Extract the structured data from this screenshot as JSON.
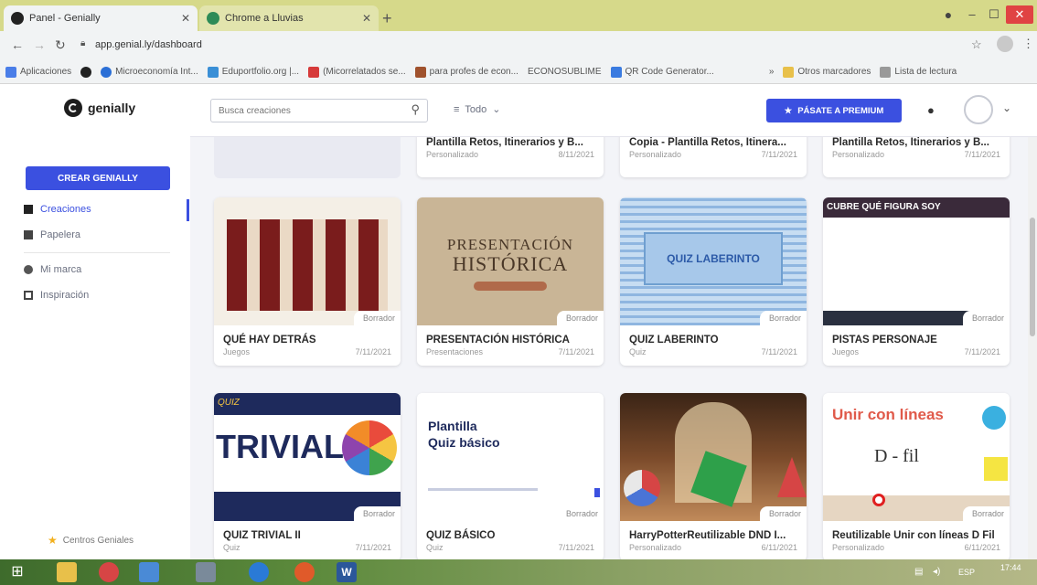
{
  "browser": {
    "tabs": [
      {
        "title": "Panel - Genially",
        "active": true
      },
      {
        "title": "Chrome a Lluvias",
        "active": false
      }
    ],
    "address": "app.genial.ly/dashboard",
    "bookmarks": [
      "Aplicaciones",
      "Microeconomía Int...",
      "Eduportfolio.org |...",
      "(Micorrelatados se...",
      "para profes de econ...",
      "ECONOSUBLIME",
      "QR Code Generator...",
      "Otros marcadores",
      "Lista de lectura"
    ]
  },
  "app": {
    "logo": "genially",
    "create_button": "CREAR GENIALLY",
    "nav": [
      "Creaciones",
      "Papelera",
      "Mi marca",
      "Inspiración"
    ],
    "footer_link": "Centros Geniales",
    "search_placeholder": "Busca creaciones",
    "filter_label": "Todo",
    "premium_button": "PÁSATE A PREMIUM"
  },
  "cards_top": [
    {
      "title": "Plantilla Retos, Itinerarios y B...",
      "type": "Personalizado",
      "date": "8/11/2021"
    },
    {
      "title": "Copia - Plantilla Retos, Itinera...",
      "type": "Personalizado",
      "date": "7/11/2021"
    },
    {
      "title": "Plantilla Retos, Itinerarios y B...",
      "type": "Personalizado",
      "date": "7/11/2021"
    }
  ],
  "cards_row2": [
    {
      "title": "QUÉ HAY DETRÁS",
      "type": "Juegos",
      "date": "7/11/2021",
      "badge": "Borrador"
    },
    {
      "title": "PRESENTACIÓN HISTÓRICA",
      "type": "Presentaciones",
      "date": "7/11/2021",
      "badge": "Borrador",
      "thumb_line1": "PRESENTACIÓN",
      "thumb_line2": "HISTÓRICA"
    },
    {
      "title": "QUIZ LABERINTO",
      "type": "Quiz",
      "date": "7/11/2021",
      "badge": "Borrador",
      "thumb_text": "QUIZ LABERINTO"
    },
    {
      "title": "PISTAS PERSONAJE",
      "type": "Juegos",
      "date": "7/11/2021",
      "badge": "Borrador",
      "thumb_text": "CUBRE QUÉ FIGURA SOY"
    }
  ],
  "cards_row3": [
    {
      "title": "QUIZ TRIVIAL II",
      "type": "Quiz",
      "date": "7/11/2021",
      "badge": "Borrador",
      "thumb_text": "TRIVIAL",
      "thumb_small": "QUIZ"
    },
    {
      "title": "QUIZ BÁSICO",
      "type": "Quiz",
      "date": "7/11/2021",
      "badge": "Borrador",
      "thumb_line1": "Plantilla",
      "thumb_line2": "Quiz básico"
    },
    {
      "title": "HarryPotterReutilizable DND I...",
      "type": "Personalizado",
      "date": "6/11/2021",
      "badge": "Borrador"
    },
    {
      "title": "Reutilizable Unir con líneas D Fil",
      "type": "Personalizado",
      "date": "6/11/2021",
      "badge": "Borrador",
      "thumb_text": "Unir con líneas"
    }
  ],
  "taskbar": {
    "lang": "ESP",
    "time": "17:44"
  },
  "colors": {
    "accent": "#3b50e0",
    "tabstrip": "#d6d98a"
  }
}
